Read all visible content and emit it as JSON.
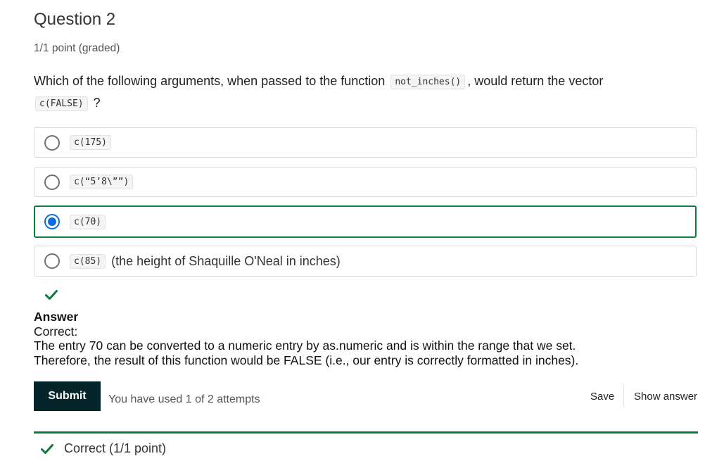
{
  "question": {
    "title": "Question 2",
    "points": "1/1 point (graded)",
    "prompt_before": "Which of the following arguments, when passed to the function",
    "prompt_code_1": "not_inches()",
    "prompt_middle": ", would return the vector",
    "prompt_code_2": "c(FALSE)",
    "prompt_after": "?"
  },
  "choices": [
    {
      "code": "c(175)",
      "extra": "",
      "selected": false
    },
    {
      "code": "c(“5’8\\””)",
      "extra": "",
      "selected": false
    },
    {
      "code": "c(70)",
      "extra": "",
      "selected": true
    },
    {
      "code": "c(85)",
      "extra": "(the height of Shaquille O'Neal in inches)",
      "selected": false
    }
  ],
  "answer": {
    "heading": "Answer",
    "status": "Correct:",
    "line1": "The entry 70 can be converted to a numeric entry by as.numeric and is within the range that we set.",
    "line2": "Therefore, the result of this function would be FALSE (i.e., our entry is correctly formatted in inches)."
  },
  "actions": {
    "submit_label": "Submit",
    "attempts_text": "You have used 1 of 2 attempts",
    "save_label": "Save",
    "show_answer_label": "Show answer"
  },
  "result": {
    "text": "Correct (1/1 point)"
  },
  "colors": {
    "correct_green": "#0d7a3e",
    "radio_blue": "#0a6ede",
    "submit_bg": "#04262b"
  },
  "icons": {
    "answer_status": "checkmark-icon",
    "result_status": "checkmark-icon"
  }
}
